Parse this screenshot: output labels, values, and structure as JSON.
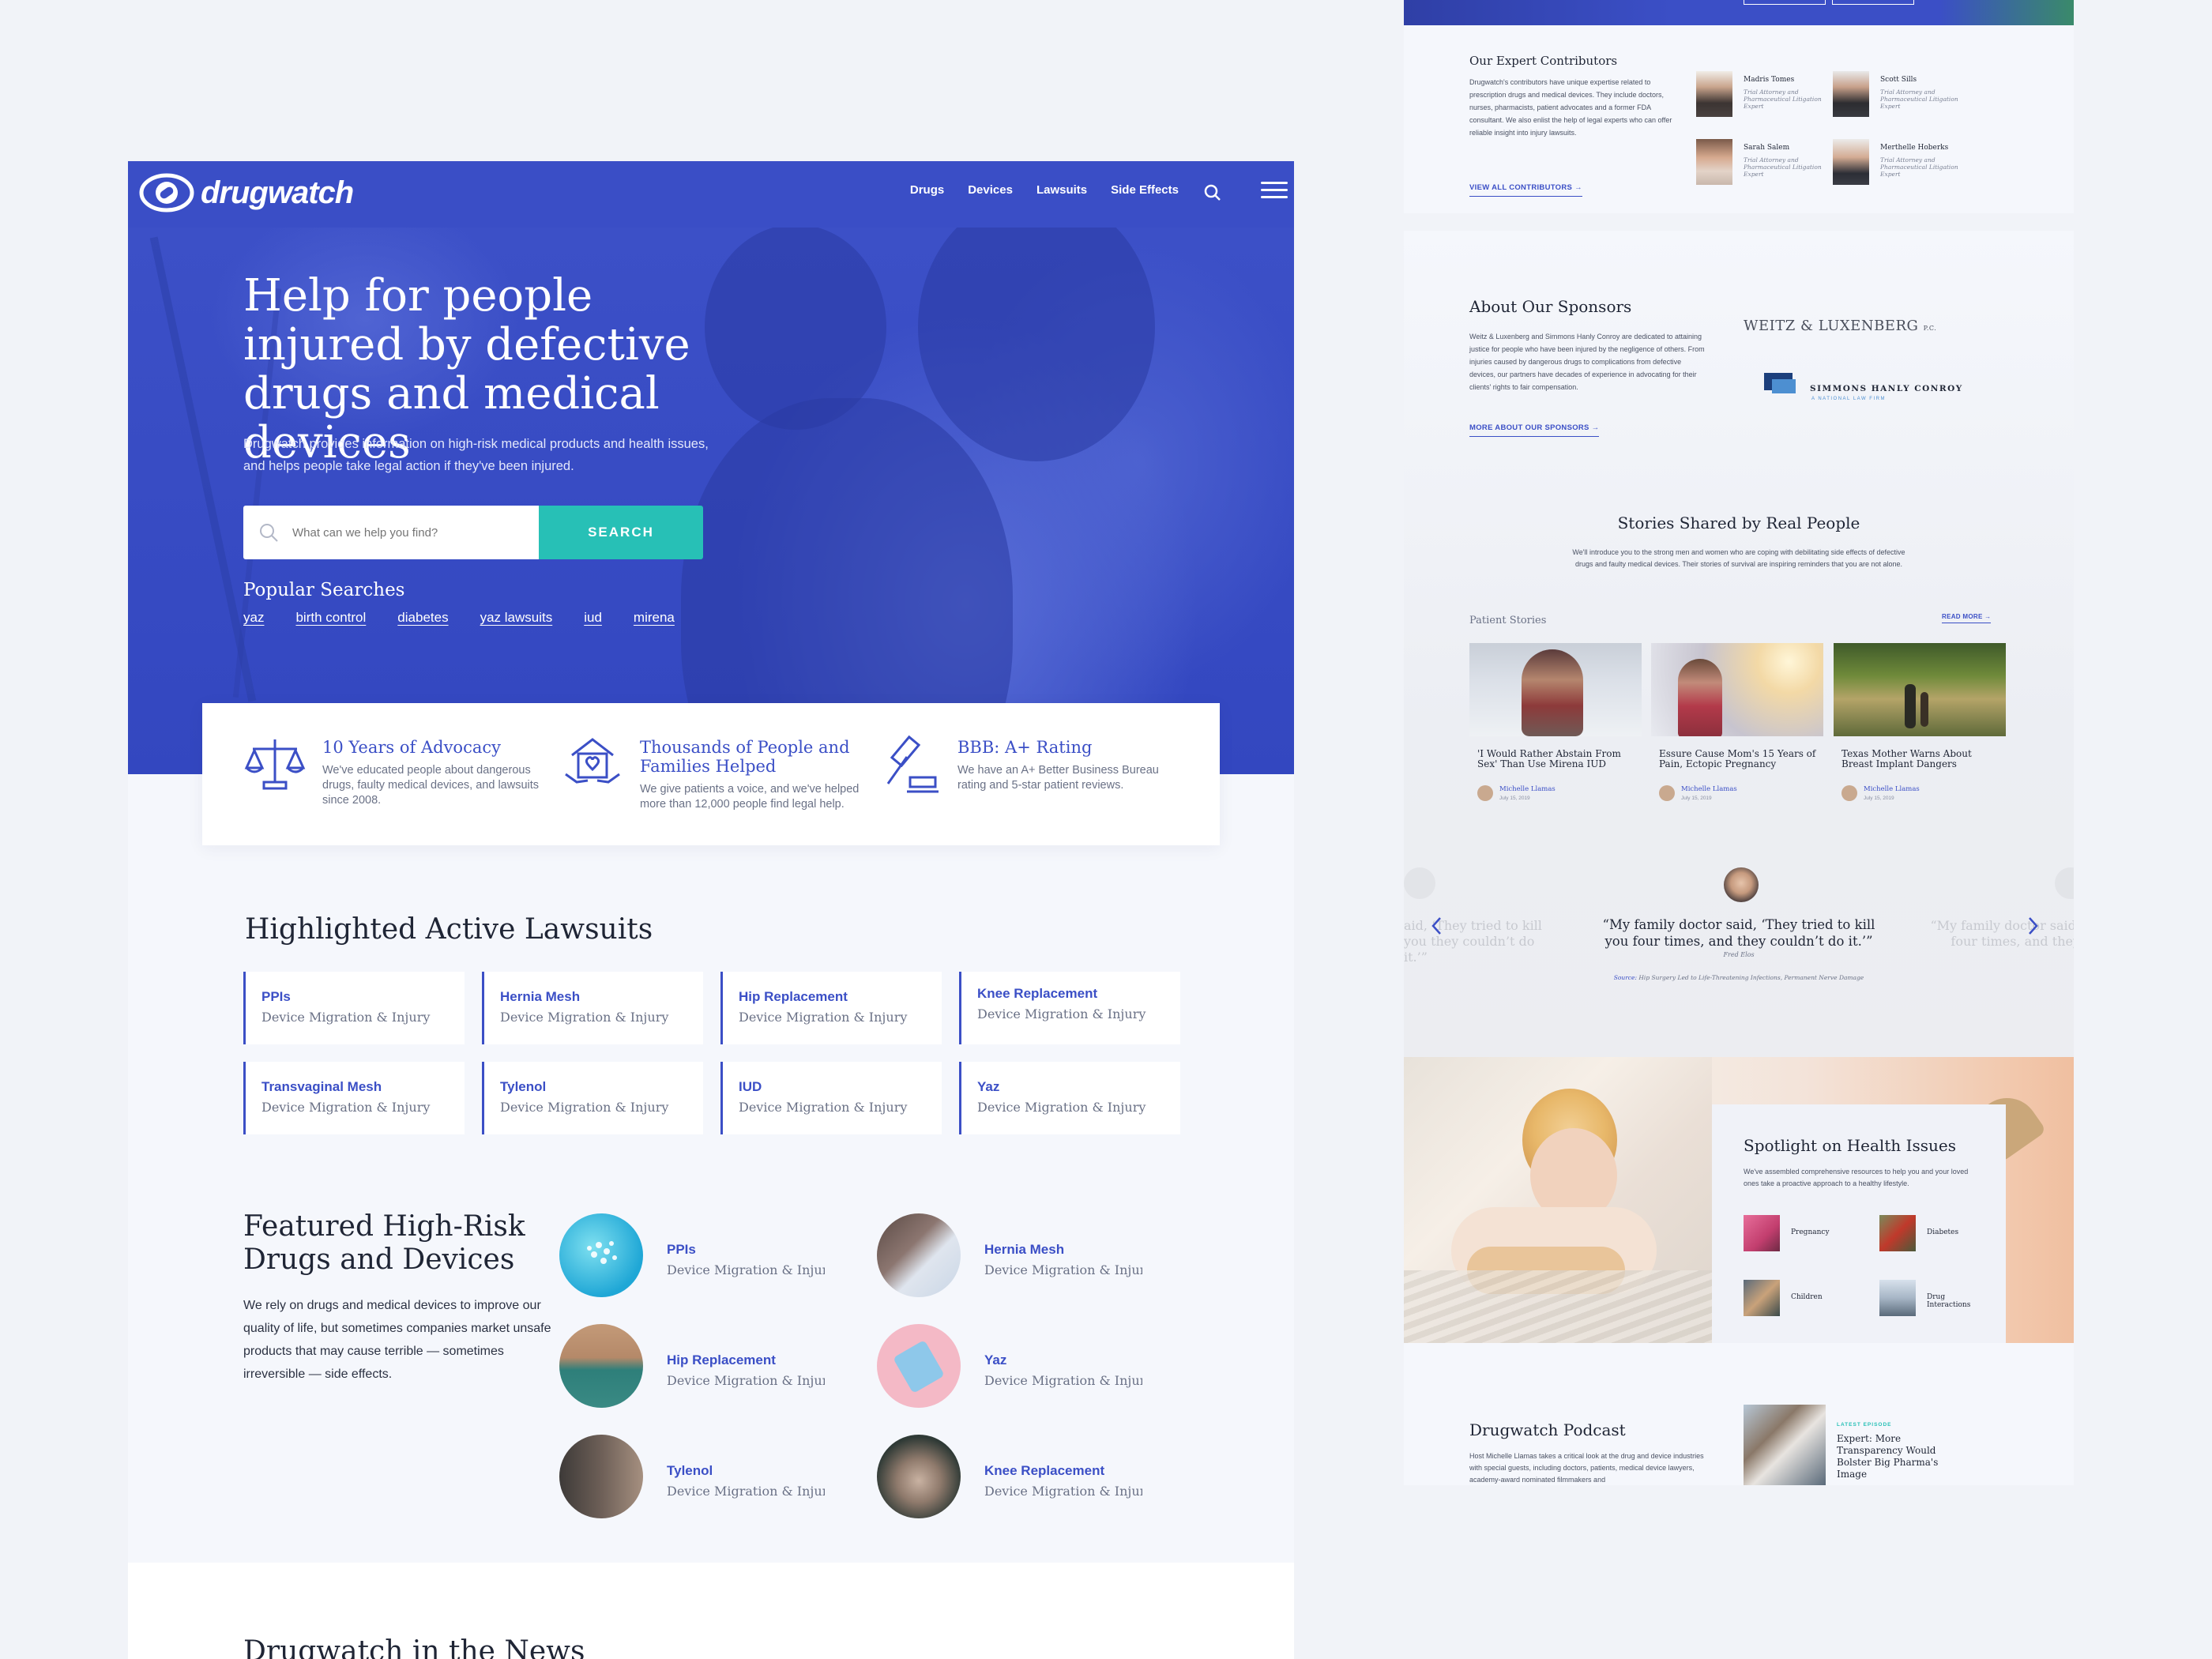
{
  "left": {
    "nav": {
      "logo_text": "drugwatch",
      "links": [
        "Drugs",
        "Devices",
        "Lawsuits",
        "Side Effects"
      ]
    },
    "hero": {
      "title": "Help for people injured by defective drugs and medical devices",
      "subtitle": "Drugwatch provides information on high-risk medical products and health issues, and helps people take legal action if they've been injured.",
      "search_placeholder": "What can we help you find?",
      "search_button": "SEARCH",
      "popular_label": "Popular Searches",
      "popular": [
        "yaz",
        "birth control",
        "diabetes",
        "yaz lawsuits",
        "iud",
        "mirena"
      ]
    },
    "features": [
      {
        "title": "10 Years of Advocacy",
        "desc": "We've educated people about dangerous drugs, faulty medical devices, and lawsuits since 2008.",
        "icon": "scales-icon"
      },
      {
        "title": "Thousands of People and Families Helped",
        "desc": "We give patients a voice, and we've helped more than 12,000 people find legal help.",
        "icon": "helping-hands-icon"
      },
      {
        "title": "BBB: A+ Rating",
        "desc": "We have an A+ Better Business Bureau rating and 5-star patient reviews.",
        "icon": "gavel-icon"
      }
    ],
    "lawsuits_title": "Highlighted Active Lawsuits",
    "lawsuits": [
      {
        "name": "PPIs",
        "sub": "Device Migration & Injury"
      },
      {
        "name": "Hernia Mesh",
        "sub": "Device Migration & Injury"
      },
      {
        "name": "Hip Replacement",
        "sub": "Device Migration & Injury"
      },
      {
        "name": "Knee Replacement",
        "sub": "Device Migration & Injury"
      },
      {
        "name": "Transvaginal Mesh",
        "sub": "Device Migration & Injury"
      },
      {
        "name": "Tylenol",
        "sub": "Device Migration & Injury"
      },
      {
        "name": "IUD",
        "sub": "Device Migration & Injury"
      },
      {
        "name": "Yaz",
        "sub": "Device Migration & Injury"
      }
    ],
    "featured_title": "Featured High-Risk Drugs and Devices",
    "featured_intro": "We rely on drugs and medical devices to improve our quality of life, but sometimes companies market unsafe products that may cause terrible — sometimes irreversible — side effects.",
    "featured": [
      {
        "name": "PPIs",
        "sub": "Device Migration & Injury"
      },
      {
        "name": "Hernia Mesh",
        "sub": "Device Migration & Injury"
      },
      {
        "name": "Hip Replacement",
        "sub": "Device Migration & Injury"
      },
      {
        "name": "Yaz",
        "sub": "Device Migration & Injury"
      },
      {
        "name": "Tylenol",
        "sub": "Device Migration & Injury"
      },
      {
        "name": "Knee Replacement",
        "sub": "Device Migration & Injury"
      }
    ],
    "news_title": "Drugwatch in the News"
  },
  "right": {
    "contributors": {
      "title": "Our Expert Contributors",
      "body": "Drugwatch's contributors have unique expertise related to prescription drugs and medical devices. They include doctors, nurses, pharmacists, patient advocates and a former FDA consultant. We also enlist the help of legal experts who can offer reliable insight into injury lawsuits.",
      "link": "VIEW ALL CONTRIBUTORS",
      "people": [
        {
          "name": "Madris Tomes",
          "role": "Trial Attorney and Pharmaceutical Litigation Expert"
        },
        {
          "name": "Scott Sills",
          "role": "Trial Attorney and Pharmaceutical Litigation Expert"
        },
        {
          "name": "Sarah Salem",
          "role": "Trial Attorney and Pharmaceutical Litigation Expert"
        },
        {
          "name": "Merthelle Hoberks",
          "role": "Trial Attorney and Pharmaceutical Litigation Expert"
        }
      ]
    },
    "sponsors": {
      "title": "About Our Sponsors",
      "body": "Weitz & Luxenberg and Simmons Hanly Conroy are dedicated to attaining justice for people who have been injured by the negligence of others. From injuries caused by dangerous drugs to complications from defective devices, our partners have decades of experience in advocating for their clients' rights to fair compensation.",
      "link": "MORE ABOUT OUR SPONSORS",
      "logo1": "WEITZ & LUXENBERG",
      "logo1_suffix": "P.C.",
      "logo2": "SIMMONS HANLY CONROY",
      "logo2_sub": "A NATIONAL LAW FIRM"
    },
    "stories": {
      "title": "Stories Shared by Real People",
      "body": "We'll introduce you to the strong men and women who are coping with debilitating side effects of defective drugs and faulty medical devices. Their stories of survival are inspiring reminders that you are not alone.",
      "section_label": "Patient Stories",
      "read_more": "READ MORE",
      "items": [
        {
          "title": "'I Would Rather Abstain From Sex' Than Use Mirena IUD",
          "author": "Michelle Llamas",
          "date": "July 15, 2019"
        },
        {
          "title": "Essure Cause Mom's 15 Years of Pain, Ectopic Pregnancy",
          "author": "Michelle Llamas",
          "date": "July 15, 2019"
        },
        {
          "title": "Texas Mother Warns About Breast Implant Dangers",
          "author": "Michelle Llamas",
          "date": "July 15, 2019"
        }
      ]
    },
    "quote": {
      "text": "“My family doctor said, ‘They tried to kill you four times, and they couldn’t do it.’”",
      "author": "Fred Elos",
      "source_label": "Source:",
      "source": "Hip Surgery Led to Life-Threatening Infections, Permanent Nerve Damage",
      "ghost_left": "aid, ‘They tried to kill you they couldn’t do it.’”",
      "ghost_right": "“My family doctor said, four times, and they"
    },
    "spotlight": {
      "title": "Spotlight on Health Issues",
      "body": "We've assembled comprehensive resources to help you and your loved ones take a proactive approach to a healthy lifestyle.",
      "items": [
        "Pregnancy",
        "Diabetes",
        "Children",
        "Drug Interactions"
      ]
    },
    "podcast": {
      "title": "Drugwatch Podcast",
      "body": "Host Michelle Llamas takes a critical look at the drug and device industries with special guests, including doctors, patients, medical device lawyers, academy-award nominated filmmakers and",
      "episode_label": "LATEST EPISODE",
      "episode_title": "Expert: More Transparency Would Bolster Big Pharma's Image"
    }
  },
  "colors": {
    "brand": "#3b4fc6",
    "accent": "#27c0b6",
    "background": "#f1f3f8"
  }
}
